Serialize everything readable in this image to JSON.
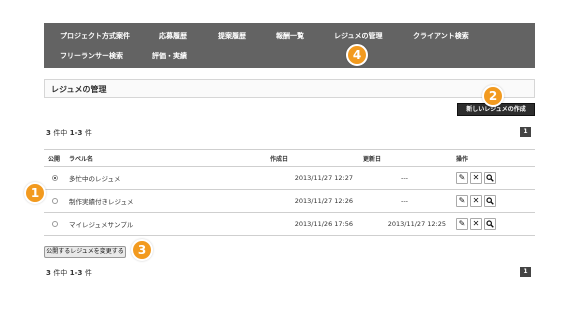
{
  "nav": {
    "row1": [
      "プロジェクト方式案件",
      "応募履歴",
      "提案履歴",
      "報酬一覧",
      "レジュメの管理",
      "クライアント検索"
    ],
    "row2": [
      "フリーランサー検索",
      "評価・実績"
    ]
  },
  "page_title": "レジュメの管理",
  "new_button_label": "新しいレジュメの作成",
  "count_top": {
    "total": "3",
    "text1": "件中",
    "range": "1-3",
    "text2": "件"
  },
  "pagination_page": "1",
  "table": {
    "headers": [
      "公開",
      "ラベル名",
      "作成日",
      "更新日",
      "操作"
    ],
    "rows": [
      {
        "selected": true,
        "label": "多忙中のレジュメ",
        "created": "2013/11/27 12:27",
        "updated": "---"
      },
      {
        "selected": false,
        "label": "制作実績付きレジュメ",
        "created": "2013/11/27 12:26",
        "updated": "---"
      },
      {
        "selected": false,
        "label": "マイレジュメサンプル",
        "created": "2013/11/26 17:56",
        "updated": "2013/11/27 12:25"
      }
    ],
    "ops_icons": [
      "pencil-icon",
      "close-icon",
      "search-icon"
    ]
  },
  "change_button_label": "公開するレジュメを変更する",
  "count_bottom": {
    "total": "3",
    "text1": "件中",
    "range": "1-3",
    "text2": "件"
  },
  "badges": [
    "1",
    "2",
    "3",
    "4"
  ],
  "colors": {
    "navbar": "#636363",
    "badge": "#f29a1f",
    "dark_button": "#2d2d2d"
  }
}
